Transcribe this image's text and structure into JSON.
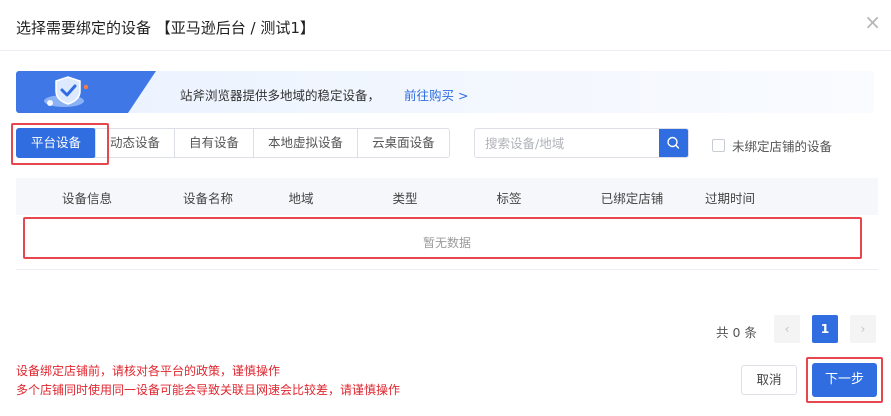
{
  "dialog": {
    "title": "选择需要绑定的设备 【亚马逊后台 / 测试1】",
    "close_icon": "close-icon"
  },
  "banner": {
    "text": "站斧浏览器提供多地域的稳定设备，",
    "link": "前往购买 >",
    "icon": "shield-check-icon"
  },
  "tabs": [
    {
      "label": "平台设备",
      "active": true
    },
    {
      "label": "动态设备",
      "active": false
    },
    {
      "label": "自有设备",
      "active": false
    },
    {
      "label": "本地虚拟设备",
      "active": false
    },
    {
      "label": "云桌面设备",
      "active": false
    }
  ],
  "search": {
    "placeholder": "搜索设备/地域",
    "value": "",
    "icon": "search-icon"
  },
  "filter": {
    "checkbox_label": "未绑定店铺的设备",
    "checked": false
  },
  "table": {
    "columns": [
      "设备信息",
      "设备名称",
      "地域",
      "类型",
      "标签",
      "已绑定店铺",
      "过期时间"
    ],
    "rows": [],
    "empty_text": "暂无数据"
  },
  "pagination": {
    "total": "共 0 条",
    "current_page": "1",
    "prev_icon": "chevron-left-icon",
    "next_icon": "chevron-right-icon"
  },
  "warnings": {
    "line1": "设备绑定店铺前，请核对各平台的政策，谨慎操作",
    "line2": "多个店铺同时使用同一设备可能会导致关联且网速会比较差，请谨慎操作"
  },
  "footer": {
    "cancel_label": "取消",
    "next_label": "下一步"
  },
  "colors": {
    "primary": "#2f6de0",
    "highlight_border": "#e7464f",
    "warning_text": "#e0262f"
  }
}
